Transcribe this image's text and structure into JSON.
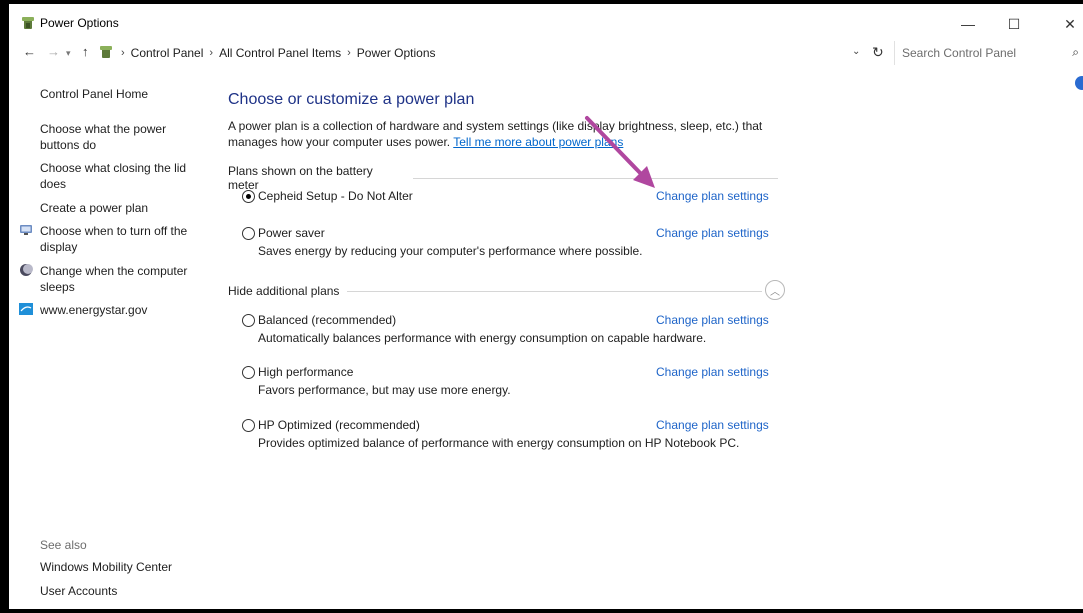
{
  "window": {
    "title": "Power Options",
    "minimize_glyph": "—",
    "maximize_glyph": "☐",
    "close_glyph": "✕"
  },
  "address_bar": {
    "crumbs": [
      "Control Panel",
      "All Control Panel Items",
      "Power Options"
    ],
    "search_placeholder": "Search Control Panel"
  },
  "sidebar": {
    "home": "Control Panel Home",
    "links": [
      "Choose what the power buttons do",
      "Choose what closing the lid does",
      "Create a power plan",
      "Choose when to turn off the display",
      "Change when the computer sleeps",
      "www.energystar.gov"
    ],
    "see_also_title": "See also",
    "see_also": [
      "Windows Mobility Center",
      "User Accounts"
    ]
  },
  "main": {
    "title": "Choose or customize a power plan",
    "intro_text": "A power plan is a collection of hardware and system settings (like display brightness, sleep, etc.) that manages how your computer uses power. ",
    "intro_link": "Tell me more about power plans",
    "battery_group": "Plans shown on the battery meter",
    "additional_group": "Hide additional plans",
    "change_label": "Change plan settings",
    "plans": [
      {
        "name": "Cepheid Setup - Do Not Alter",
        "desc": "",
        "selected": true
      },
      {
        "name": "Power saver",
        "desc": "Saves energy by reducing your computer's performance where possible.",
        "selected": false
      },
      {
        "name": "Balanced (recommended)",
        "desc": "Automatically balances performance with energy consumption on capable hardware.",
        "selected": false
      },
      {
        "name": "High performance",
        "desc": "Favors performance, but may use more energy.",
        "selected": false
      },
      {
        "name": "HP Optimized (recommended)",
        "desc": "Provides optimized balance of performance with energy consumption on HP Notebook PC.",
        "selected": false
      }
    ]
  },
  "colors": {
    "title_blue": "#1e3287",
    "link_blue": "#1e64c8",
    "annotation_arrow": "#b0479f"
  }
}
